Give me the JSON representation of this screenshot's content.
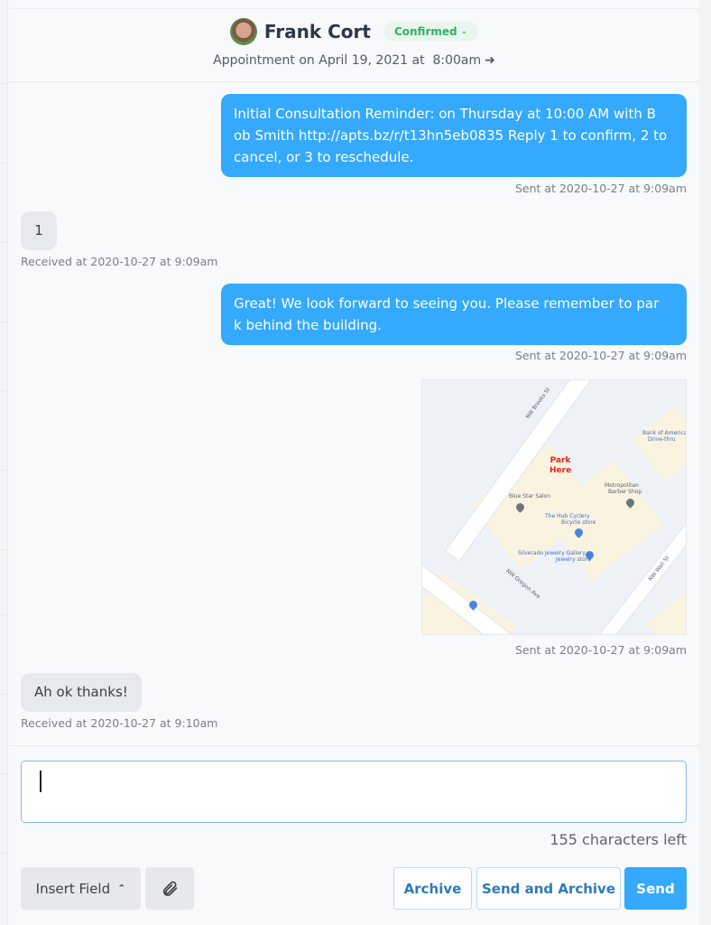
{
  "header": {
    "contact_name": "Frank Cort",
    "status": "Confirmed",
    "status_icon": "chevron-down-icon",
    "appointment": "Appointment on April 19, 2021 at  8:00am",
    "appointment_icon": "arrow-right-icon"
  },
  "messages": [
    {
      "direction": "out",
      "text": "Initial Consultation Reminder: on Thursday at 10:00 AM with B ob Smith http://apts.bz/r/t13hn5eb0835 Reply 1 to confirm, 2 to cancel, or 3 to reschedule.",
      "line1": "Initial Consultation Reminder: on Thursday at 10:00 AM with B",
      "line2": "ob Smith http://apts.bz/r/t13hn5eb0835 Reply 1 to confirm, 2 to",
      "line3": "cancel, or 3 to reschedule.",
      "stamp": "Sent at 2020-10-27 at 9:09am"
    },
    {
      "direction": "in",
      "text": "1",
      "stamp": "Received at 2020-10-27 at 9:09am"
    },
    {
      "direction": "out",
      "text": "Great! We look forward to seeing you. Please remember to par k behind the building.",
      "line1": "Great! We look forward to seeing you. Please remember to par",
      "line2": "k behind the building.",
      "stamp": "Sent at 2020-10-27 at 9:09am"
    },
    {
      "direction": "out",
      "type": "image",
      "stamp": "Sent at 2020-10-27 at 9:09am",
      "map": {
        "park_label_1": "Park",
        "park_label_2": "Here",
        "streets": [
          "NW Brooks St",
          "NW Oregon Ave",
          "NW Wall St"
        ],
        "places": [
          "Bank of America",
          "Drive-thru",
          "Metropolitan",
          "Barber Shop",
          "Blue Star Salon",
          "The Hub Cyclery",
          "Bicycle store",
          "Silverado Jewelry Gallery",
          "Jewelry store"
        ]
      }
    },
    {
      "direction": "in",
      "text": "Ah ok thanks!",
      "stamp": "Received at 2020-10-27 at 9:10am"
    }
  ],
  "composer": {
    "value": "",
    "chars_left": "155 characters left"
  },
  "actions": {
    "insert_field": "Insert Field",
    "insert_field_icon": "chevron-up-icon",
    "attach_icon": "paperclip-icon",
    "archive": "Archive",
    "send_and_archive": "Send and Archive",
    "send": "Send"
  },
  "colors": {
    "accent": "#35a9fb",
    "confirmed": "#2fb35f",
    "park_label": "#e0241b"
  }
}
